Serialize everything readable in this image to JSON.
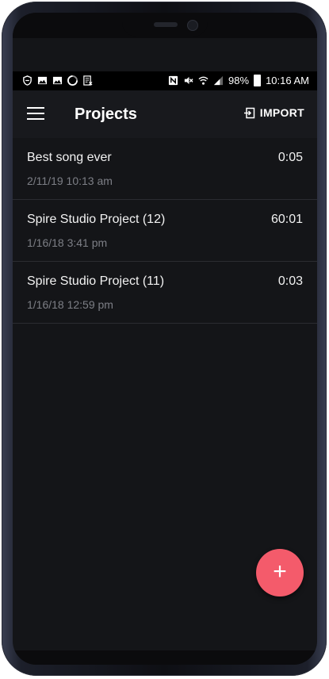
{
  "status_bar": {
    "battery": "98%",
    "time": "10:16 AM",
    "left_icons": [
      "shield-icon",
      "image-icon",
      "image-icon",
      "sync-icon",
      "file-icon"
    ],
    "right_icons": [
      "nfc-icon",
      "mute-icon",
      "wifi-icon",
      "signal-icon",
      "battery-icon"
    ]
  },
  "toolbar": {
    "title": "Projects",
    "import_label": "IMPORT",
    "menu_icon": "menu-icon",
    "import_icon": "import-icon"
  },
  "projects": [
    {
      "name": "Best song ever",
      "date": "2/11/19 10:13 am",
      "duration": "0:05"
    },
    {
      "name": "Spire Studio Project (12)",
      "date": "1/16/18 3:41 pm",
      "duration": "60:01"
    },
    {
      "name": "Spire Studio Project (11)",
      "date": "1/16/18 12:59 pm",
      "duration": "0:03"
    }
  ],
  "fab": {
    "label": "+",
    "icon": "plus-icon",
    "color": "#f45b6b"
  },
  "colors": {
    "background": "#141518",
    "toolbar": "#18191d",
    "accent": "#f45b6b"
  }
}
